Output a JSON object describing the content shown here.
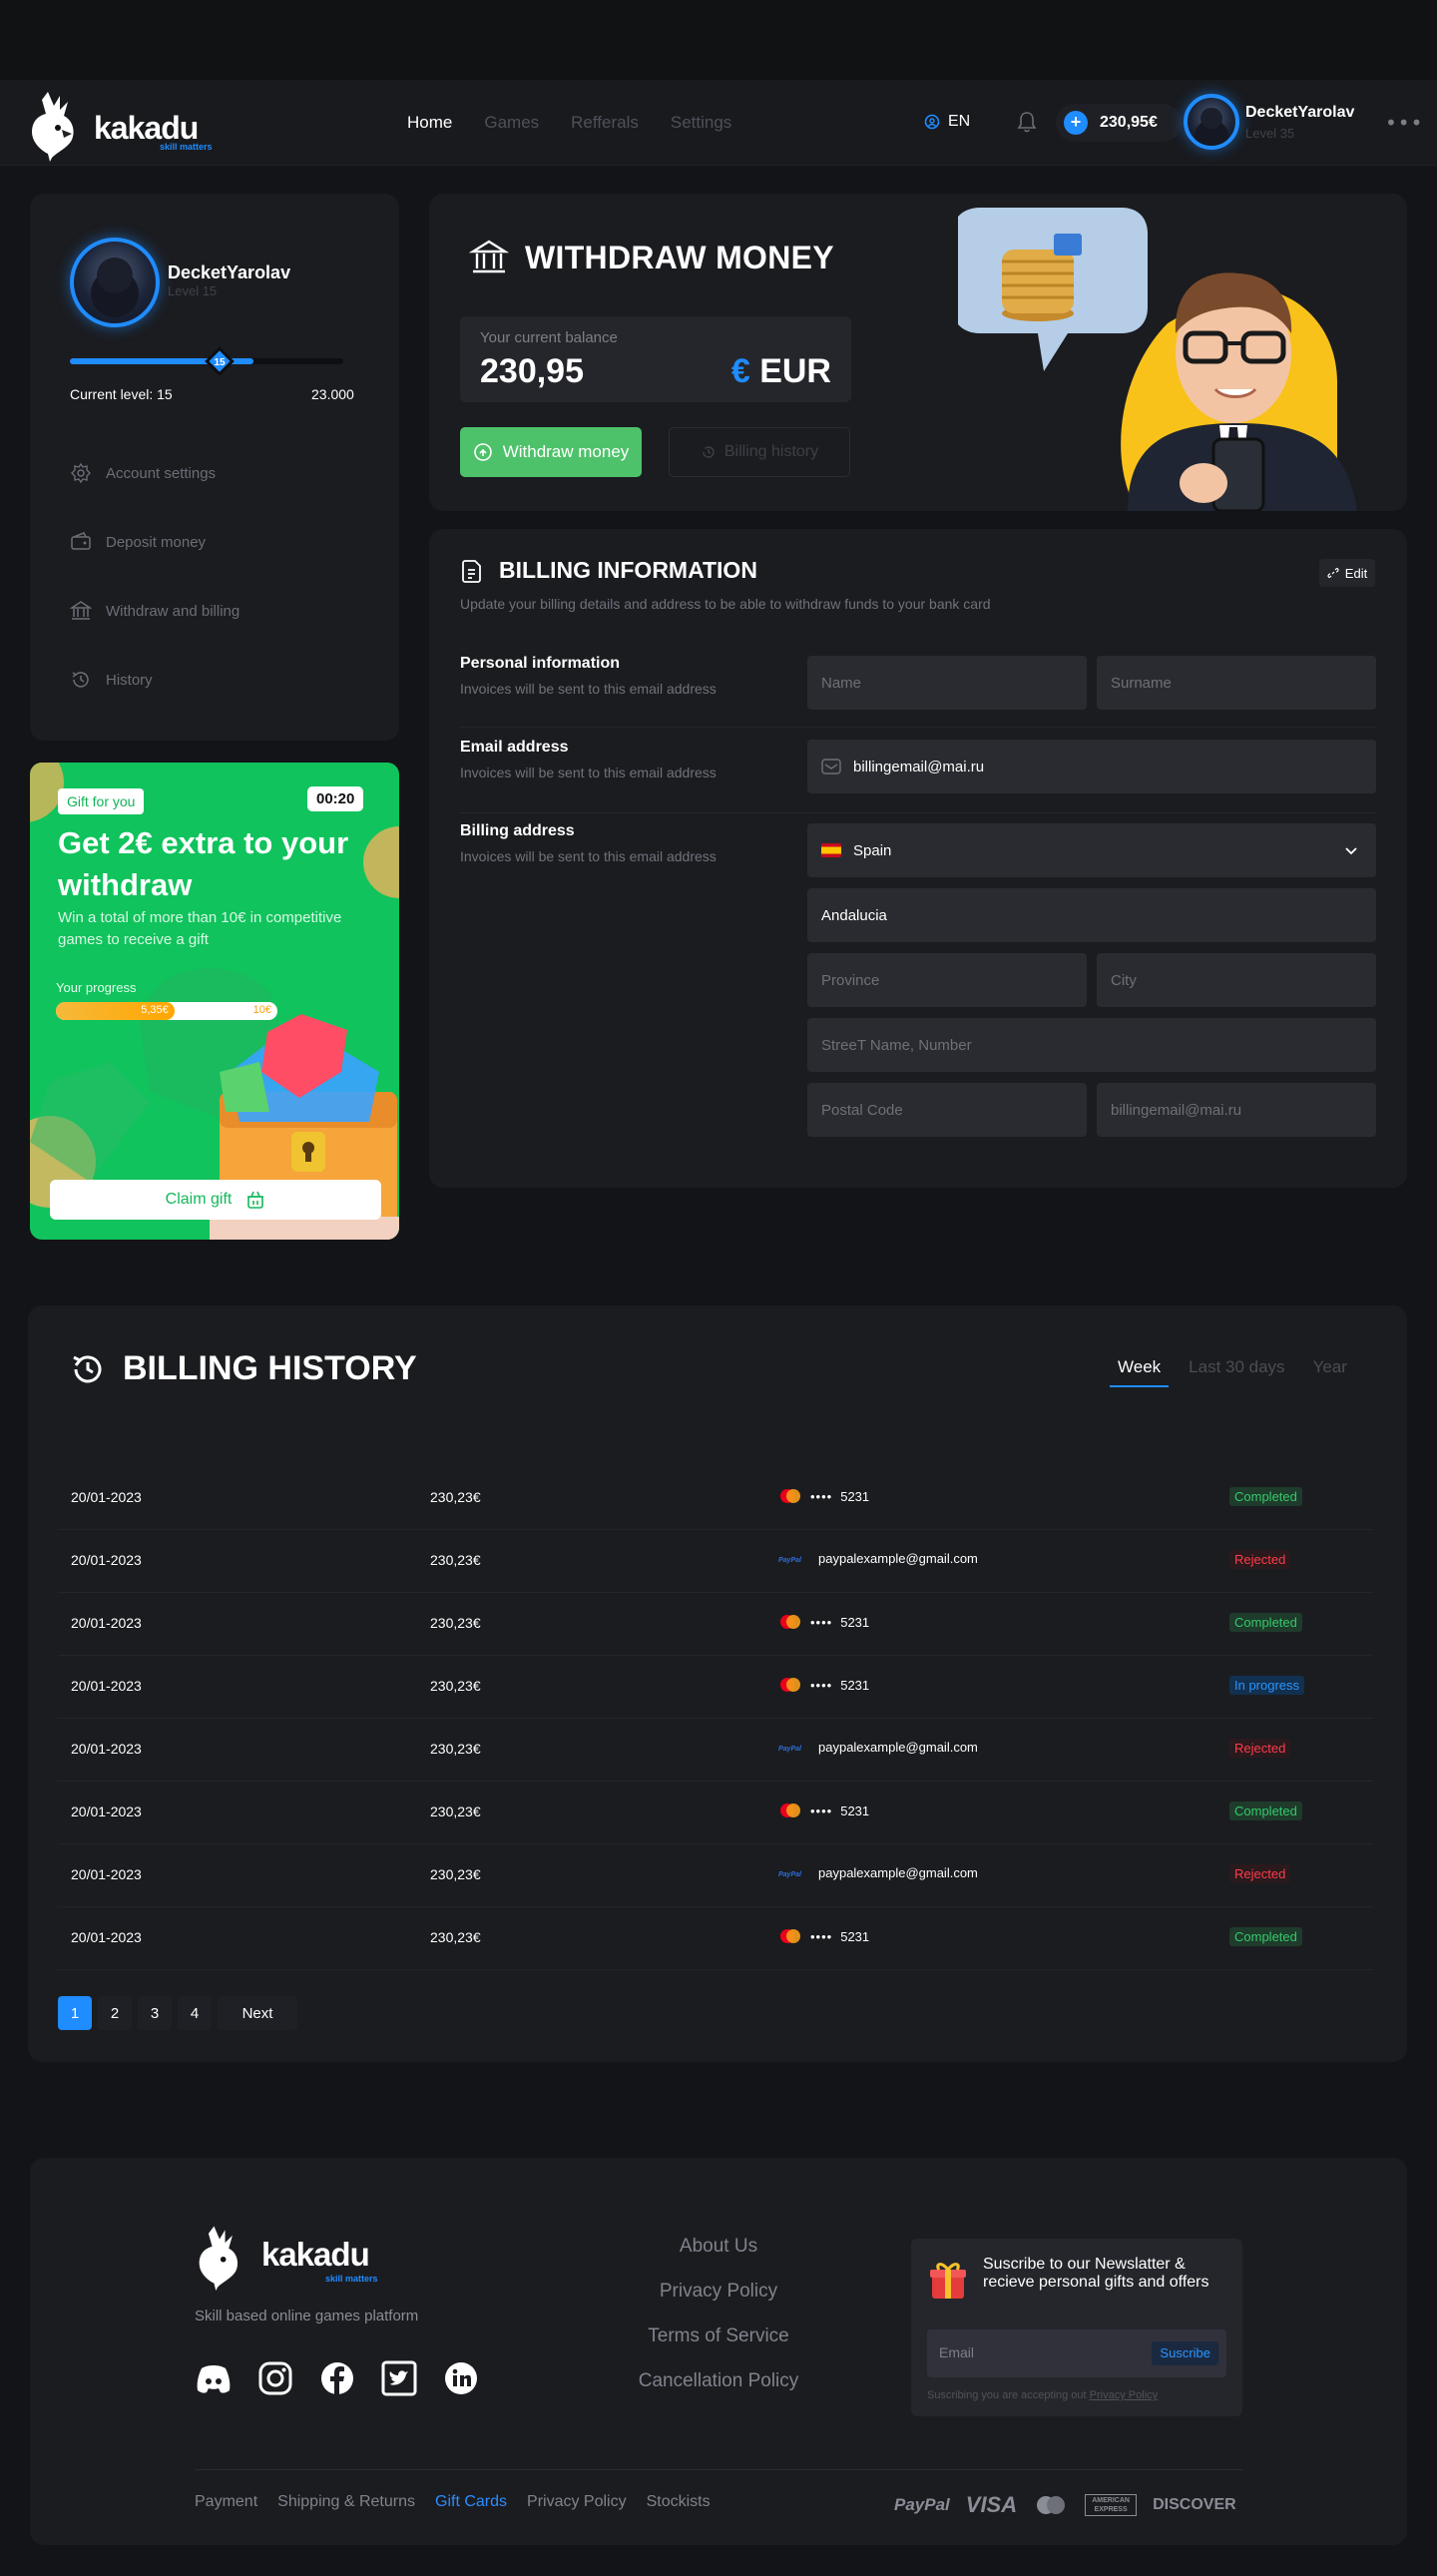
{
  "header": {
    "logo_word": "kakadu",
    "logo_tagline": "skill matters",
    "nav": [
      "Home",
      "Games",
      "Refferals",
      "Settings"
    ],
    "active_nav": "Home",
    "language": "EN",
    "balance": "230,95€",
    "user_name": "DecketYarolav",
    "user_level": "Level 35"
  },
  "profile": {
    "name": "DecketYarolav",
    "level": "Level 15",
    "level_badge": "15",
    "progress_fraction": 0.67,
    "current_level_label": "Current level: 15",
    "target_label": "23.000",
    "menu": [
      {
        "label": "Account settings",
        "icon": "gear-icon"
      },
      {
        "label": "Deposit money",
        "icon": "wallet-icon"
      },
      {
        "label": "Withdraw and billing",
        "icon": "bank-icon"
      },
      {
        "label": "History",
        "icon": "history-icon"
      }
    ]
  },
  "gift": {
    "badge": "Gift for you",
    "timer": "00:20",
    "title": "Get 2€ extra to your withdraw",
    "description": "Win a total of more than 10€ in competitive games to receive a gift",
    "progress_label": "Your progress",
    "progress_value": "5,35€",
    "progress_max": "10€",
    "progress_fraction": 0.535,
    "claim_label": "Claim gift"
  },
  "withdraw": {
    "title": "WITHDRAW MONEY",
    "balance_label": "Your current balance",
    "balance_value": "230,95",
    "currency_symbol": "€",
    "currency_code": "EUR",
    "withdraw_btn": "Withdraw money",
    "history_btn": "Billing history"
  },
  "billing_info": {
    "title": "BILLING INFORMATION",
    "subtitle": "Update your billing details and address to be able to withdraw funds to your bank card",
    "edit_label": "Edit",
    "personal_label": "Personal information",
    "personal_sub": "Invoices will be sent to this email address",
    "name_placeholder": "Name",
    "surname_placeholder": "Surname",
    "email_label": "Email address",
    "email_sub": "Invoices will be sent to this email address",
    "email_value": "billingemail@mai.ru",
    "address_label": "Billing address",
    "address_sub": "Invoices will be sent to this email address",
    "country": "Spain",
    "region": "Andalucia",
    "province_placeholder": "Province",
    "city_placeholder": "City",
    "street_placeholder": "StreeT Name, Number",
    "postal_placeholder": "Postal Code",
    "extra_placeholder": "billingemail@mai.ru"
  },
  "billing_history": {
    "title": "BILLING HISTORY",
    "tabs": [
      "Week",
      "Last 30 days",
      "Year"
    ],
    "active_tab": "Week",
    "rows": [
      {
        "date": "20/01-2023",
        "amount": "230,23€",
        "method": "card",
        "dots": "••••",
        "detail": "5231",
        "status": "Completed"
      },
      {
        "date": "20/01-2023",
        "amount": "230,23€",
        "method": "paypal",
        "dots": "",
        "detail": "paypalexample@gmail.com",
        "status": "Rejected"
      },
      {
        "date": "20/01-2023",
        "amount": "230,23€",
        "method": "card",
        "dots": "••••",
        "detail": "5231",
        "status": "Completed"
      },
      {
        "date": "20/01-2023",
        "amount": "230,23€",
        "method": "card",
        "dots": "••••",
        "detail": "5231",
        "status": "In progress"
      },
      {
        "date": "20/01-2023",
        "amount": "230,23€",
        "method": "paypal",
        "dots": "",
        "detail": "paypalexample@gmail.com",
        "status": "Rejected"
      },
      {
        "date": "20/01-2023",
        "amount": "230,23€",
        "method": "card",
        "dots": "••••",
        "detail": "5231",
        "status": "Completed"
      },
      {
        "date": "20/01-2023",
        "amount": "230,23€",
        "method": "paypal",
        "dots": "",
        "detail": "paypalexample@gmail.com",
        "status": "Rejected"
      },
      {
        "date": "20/01-2023",
        "amount": "230,23€",
        "method": "card",
        "dots": "••••",
        "detail": "5231",
        "status": "Completed"
      }
    ],
    "pages": [
      "1",
      "2",
      "3",
      "4"
    ],
    "active_page": "1",
    "next_label": "Next"
  },
  "footer": {
    "logo_word": "kakadu",
    "logo_tagline": "skill matters",
    "tagline": "Skill based online games platform",
    "socials": [
      "discord-icon",
      "instagram-icon",
      "facebook-icon",
      "twitter-icon",
      "linkedin-icon"
    ],
    "links": [
      "About Us",
      "Privacy Policy",
      "Terms of Service",
      "Cancellation Policy"
    ],
    "newsletter_text": "Suscribe to our Newslatter & recieve personal gifts and offers",
    "newsletter_placeholder": "Email",
    "newsletter_btn": "Suscribe",
    "newsletter_note": "Suscribing you are accepting out",
    "newsletter_note_link": "Privacy Policy",
    "bottom_links": [
      "Payment",
      "Shipping & Returns",
      "Gift Cards",
      "Privacy Policy",
      "Stockists"
    ],
    "active_bottom_link": "Gift Cards",
    "payments": [
      "PayPal",
      "VISA",
      "AMERICAN EXPRESS",
      "DISCOVER"
    ]
  },
  "colors": {
    "accent": "#1f8cff",
    "green": "#4ec26a",
    "gift_bg": "#10c35c",
    "panel": "#1b1c20",
    "background": "#131417"
  }
}
